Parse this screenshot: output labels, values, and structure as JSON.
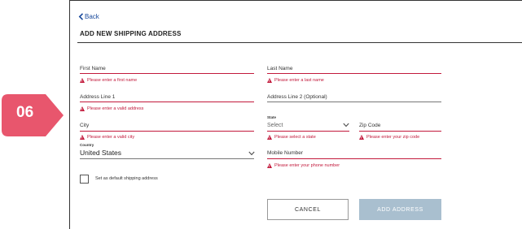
{
  "header": {
    "back_label": "Back",
    "title": "ADD NEW SHIPPING ADDRESS"
  },
  "step_badge": {
    "number": "06",
    "color": "#e8566d"
  },
  "form": {
    "first_name": {
      "label": "First Name",
      "error": "Please enter a first name"
    },
    "last_name": {
      "label": "Last Name",
      "error": "Please enter a last name"
    },
    "address1": {
      "label": "Address Line 1",
      "error": "Please enter a valid address"
    },
    "address2": {
      "label": "Address Line 2 (Optional)"
    },
    "city": {
      "label": "City",
      "error": "Please enter a valid city"
    },
    "state": {
      "small_label": "State",
      "placeholder": "Select",
      "error": "Please select a state"
    },
    "zip": {
      "label": "Zip Code",
      "error": "Please enter your zip code"
    },
    "country": {
      "small_label": "Country",
      "value": "United States"
    },
    "mobile": {
      "label": "Mobile Number",
      "error": "Please enter your phone number"
    },
    "default_checkbox": {
      "label": "Set as default shipping address",
      "checked": false
    }
  },
  "buttons": {
    "cancel": "CANCEL",
    "add": "ADD ADDRESS"
  },
  "colors": {
    "error": "#c2193b",
    "link": "#1a4a9c",
    "add_button_disabled": "#a9bfcf"
  }
}
